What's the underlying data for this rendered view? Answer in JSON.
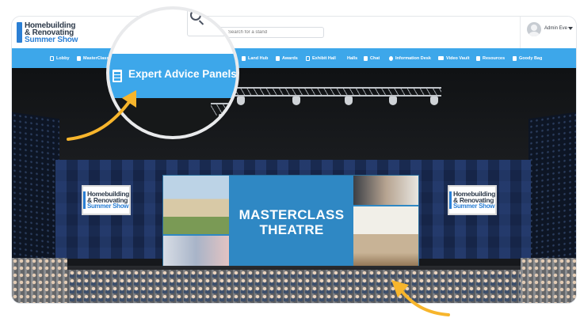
{
  "header": {
    "logo": {
      "line1": "Homebuilding",
      "line2": "& Renovating",
      "line3": "Summer Show"
    },
    "search": {
      "placeholder": "Search for a stand"
    },
    "user": {
      "name": "Admin Eve"
    }
  },
  "nav": {
    "items": [
      {
        "label": "Lobby",
        "icon": "page-icon"
      },
      {
        "label": "MasterClass",
        "icon": "building-icon"
      },
      {
        "label": "Land Hub",
        "icon": "building-icon"
      },
      {
        "label": "Awards",
        "icon": "building-icon"
      },
      {
        "label": "Exhibit Hall",
        "icon": "page-icon"
      },
      {
        "label": "Halls",
        "icon": ""
      },
      {
        "label": "Chat",
        "icon": "chat-icon"
      },
      {
        "label": "Information Desk",
        "icon": "info-icon"
      },
      {
        "label": "Video Vault",
        "icon": "video-icon"
      },
      {
        "label": "Resources",
        "icon": "folder-icon"
      },
      {
        "label": "Goody Bag",
        "icon": "bag-icon"
      }
    ]
  },
  "magnifier": {
    "label": "Expert Advice Panels",
    "icon": "building-icon"
  },
  "theatre": {
    "screen_title_line1": "MASTERCLASS",
    "screen_title_line2": "THEATRE",
    "sign_left": {
      "line1": "Homebuilding",
      "line2": "& Renovating",
      "line3": "Summer Show"
    },
    "sign_right": {
      "line1": "Homebuilding",
      "line2": "& Renovating",
      "line3": "Summer Show"
    }
  },
  "colors": {
    "nav_blue": "#3da7ea",
    "brand_blue": "#2b7fd4",
    "arrow_yellow": "#f7b52c",
    "screen_blue": "#2f88c4"
  }
}
